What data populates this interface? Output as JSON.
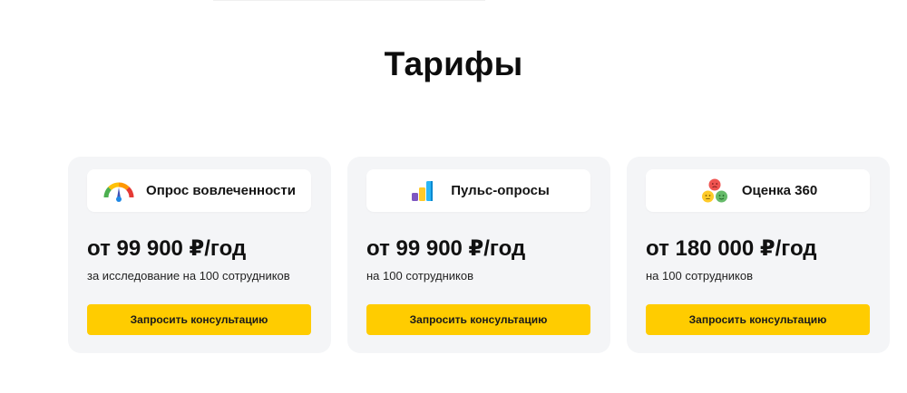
{
  "page": {
    "title": "Тарифы"
  },
  "colors": {
    "accent": "#ffcc00",
    "card_bg": "#f4f5f7"
  },
  "plans": [
    {
      "name": "Опрос вовлеченности",
      "icon": "gauge-icon",
      "price": "от 99 900 ₽/год",
      "note": "за исследование на 100 сотрудников",
      "cta": "Запросить консультацию"
    },
    {
      "name": "Пульс-опросы",
      "icon": "bar-chart-icon",
      "price": "от 99 900 ₽/год",
      "note": "на 100 сотрудников",
      "cta": "Запросить консультацию"
    },
    {
      "name": "Оценка 360",
      "icon": "faces-icon",
      "price": "от 180 000 ₽/год",
      "note": "на 100 сотрудников",
      "cta": "Запросить консультацию"
    }
  ]
}
